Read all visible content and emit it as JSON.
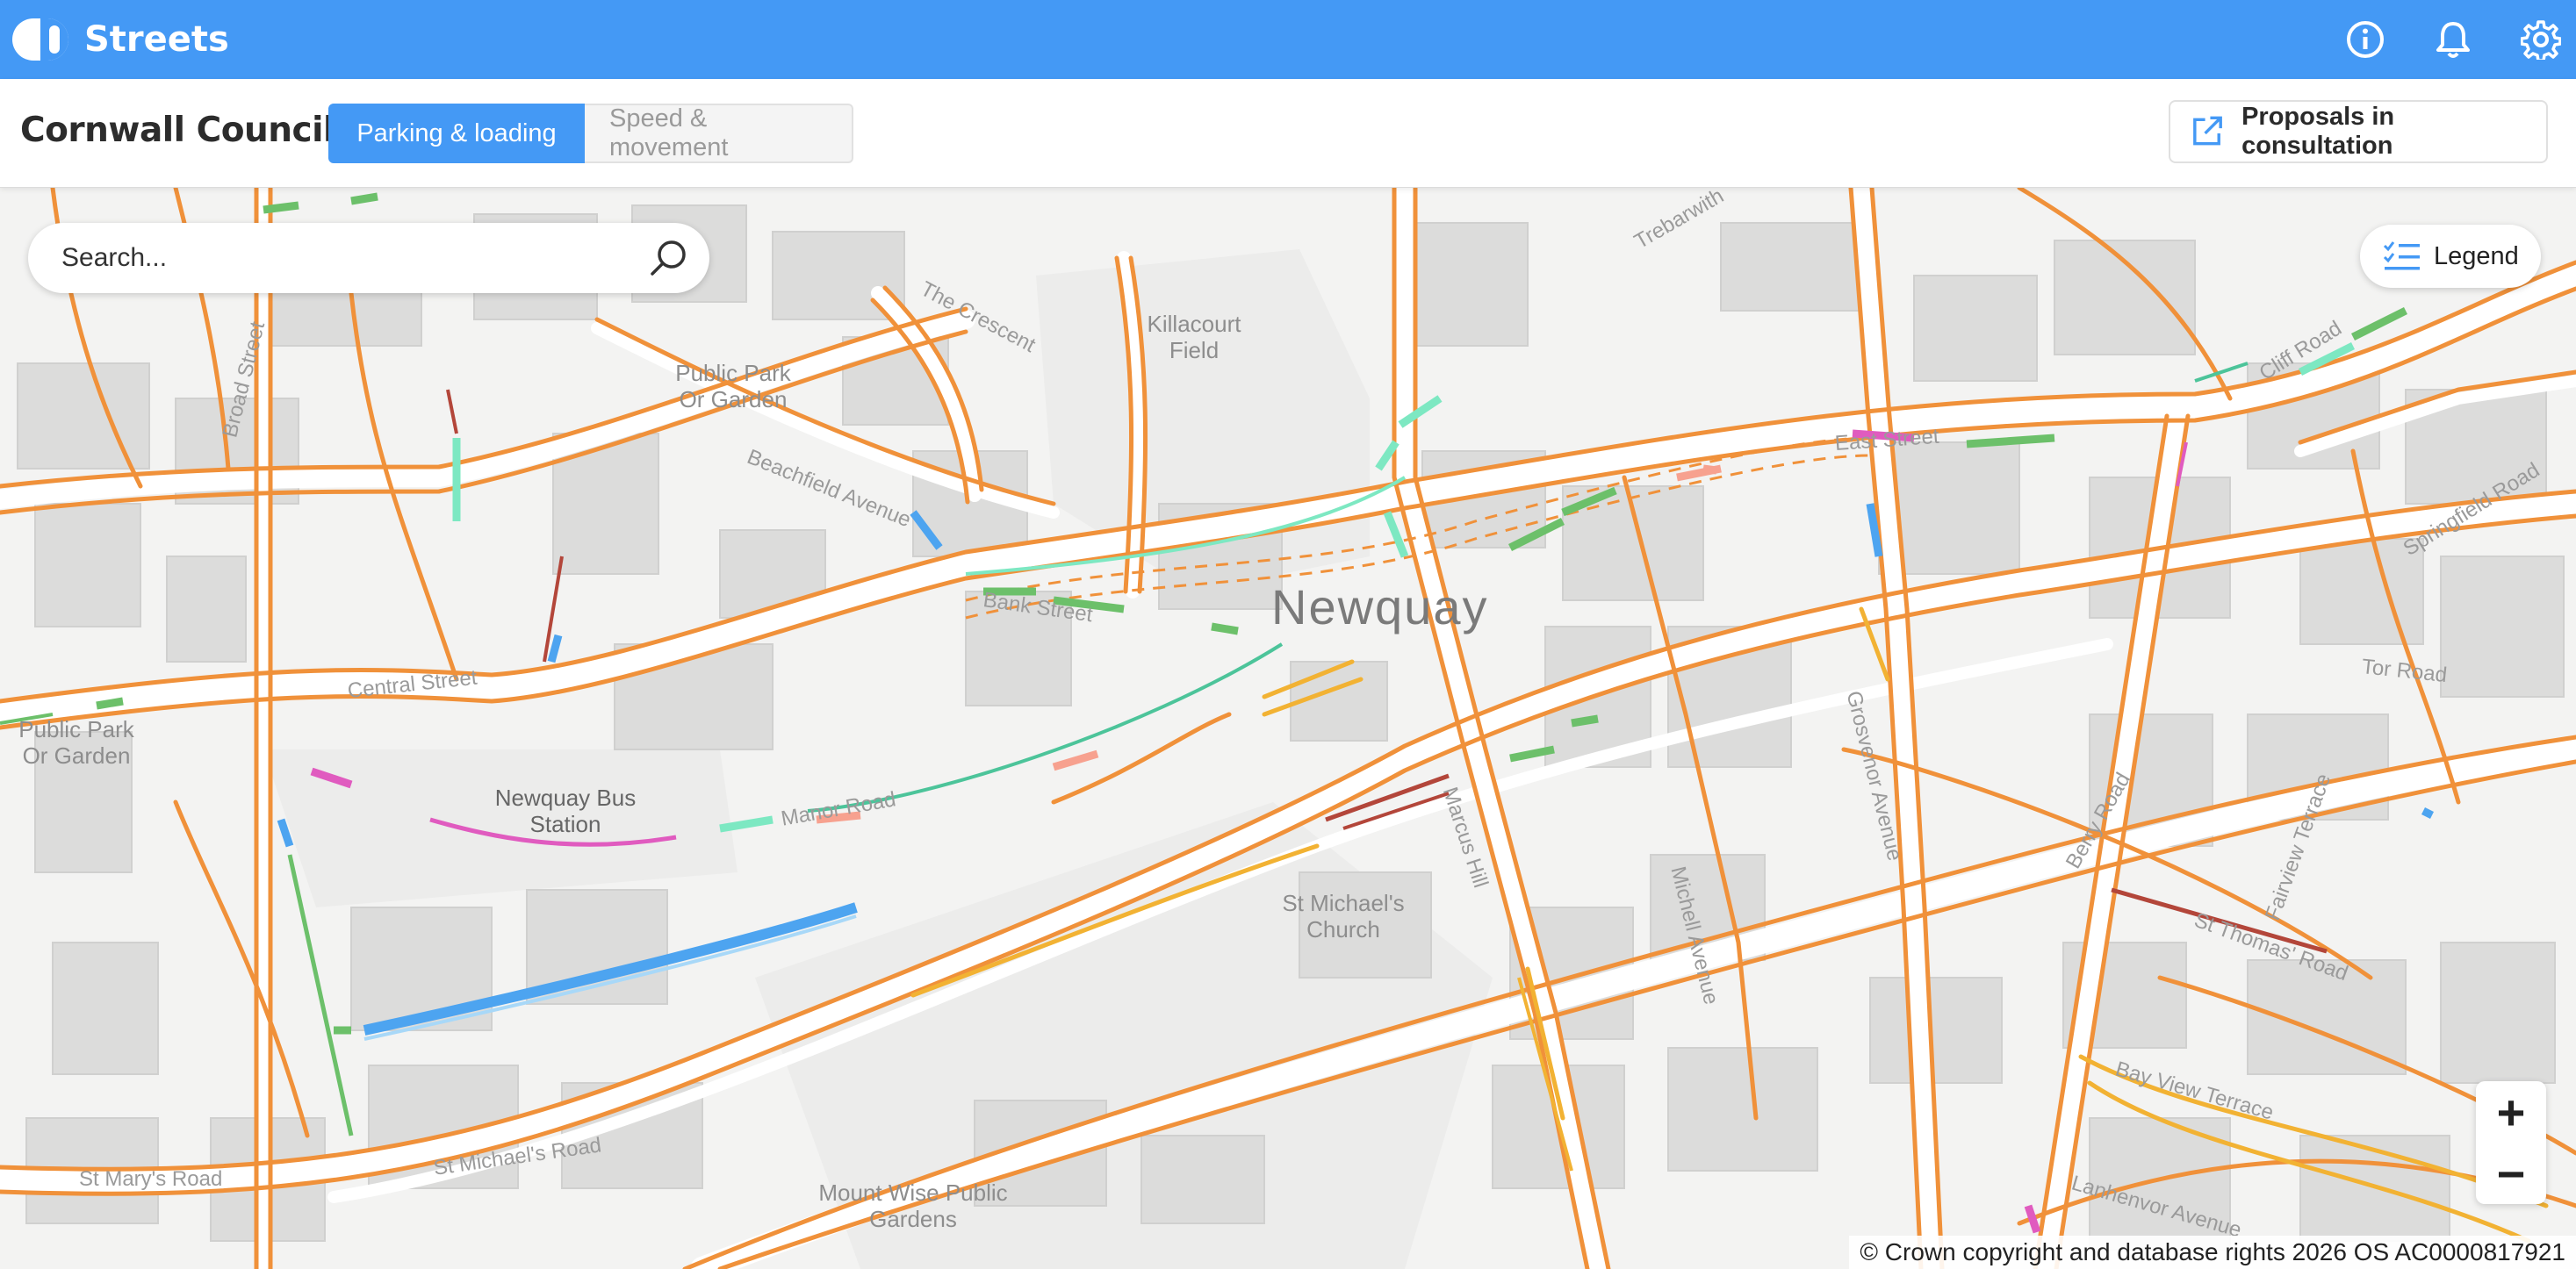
{
  "app": {
    "name": "Streets"
  },
  "header": {
    "icons": [
      "info-icon",
      "bell-icon",
      "gear-icon"
    ]
  },
  "subbar": {
    "council": "Cornwall Council",
    "tabs": [
      {
        "label": "Parking & loading",
        "active": true
      },
      {
        "label": "Speed & movement",
        "active": false
      }
    ],
    "proposals_label": "Proposals in consultation"
  },
  "search": {
    "placeholder": "Search..."
  },
  "legend": {
    "label": "Legend"
  },
  "zoom": {
    "in": "+",
    "out": "−"
  },
  "attribution": "© Crown copyright and database rights 2026 OS AC0000817921",
  "map": {
    "town": "Newquay",
    "places": [
      "Killacourt Field",
      "Public Park Or Garden",
      "Public Park Or Garden",
      "Newquay Bus Station",
      "St Michael's Church",
      "Mount Wise Public Gardens"
    ],
    "streets": [
      "The Crescent",
      "Beachfield Avenue",
      "Bank Street",
      "East Street",
      "Cliff Road",
      "Springfield Road",
      "Tor Road",
      "Grosvenor Avenue",
      "Michell Avenue",
      "Marcus Hill",
      "Manor Road",
      "Central Street",
      "Fairview Terrace",
      "Berry Road",
      "St Thomas' Road",
      "Bay View Terrace",
      "Lanhenvor Avenue",
      "St Michael's Road",
      "St Mary's Road",
      "Broad Street",
      "Trebarwith"
    ]
  },
  "colors": {
    "primary": "#4499f5",
    "road_outline": "#f0913a",
    "single_yellow": "#f2b233",
    "bay_green": "#6cc06a",
    "bay_blue": "#4da4f0",
    "bay_pink": "#e05bbf",
    "bay_red": "#b3463a",
    "bay_mint": "#7de8c2"
  }
}
